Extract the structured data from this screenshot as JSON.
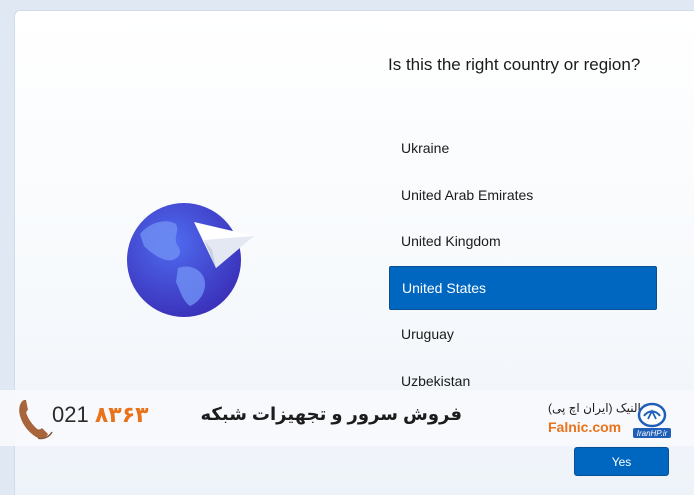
{
  "dialog": {
    "question": "Is this the right country or region?"
  },
  "countries": [
    {
      "label": "Ukraine",
      "selected": false
    },
    {
      "label": "United Arab Emirates",
      "selected": false
    },
    {
      "label": "United Kingdom",
      "selected": false
    },
    {
      "label": "United States",
      "selected": true
    },
    {
      "label": "Uruguay",
      "selected": false
    },
    {
      "label": "Uzbekistan",
      "selected": false
    }
  ],
  "actions": {
    "yes_label": "Yes"
  },
  "banner": {
    "phone_area": "021",
    "phone_number": "۸۳۶۳",
    "slogan": "فروش سرور و تجهیزات شبکه",
    "brand_fa": "فالنیک (ایران اچ پی)",
    "brand_en": "Falnic.com",
    "logo_text": "IranHP.ir"
  },
  "colors": {
    "accent": "#0067c0",
    "brand_orange": "#e8731a",
    "globe_blue": "#3d52d6",
    "globe_land": "#6f8df2"
  },
  "icons": [
    "globe-icon",
    "paper-plane-icon",
    "phone-icon",
    "iranhp-logo-icon"
  ]
}
